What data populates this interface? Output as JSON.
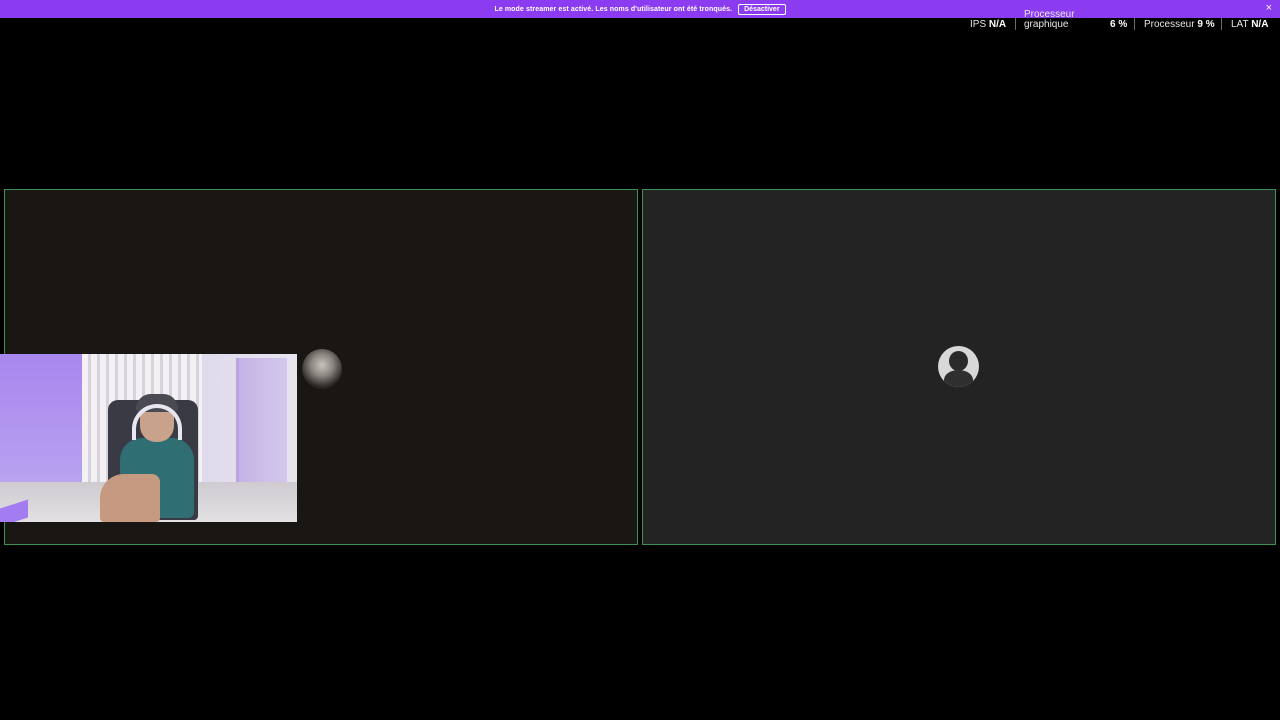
{
  "banner": {
    "message": "Le mode streamer est activé. Les noms d'utilisateur ont été tronqués.",
    "disable_label": "Désactiver",
    "close_glyph": "×",
    "background_color": "#8c3cf0"
  },
  "perf_overlay": {
    "fps_label": "IPS",
    "fps_value": "N/A",
    "gpu_label_line1": "Processeur",
    "gpu_label_line2": "graphique",
    "gpu_value": "6 %",
    "cpu_label": "Processeur",
    "cpu_value": "9 %",
    "latency_label": "LAT",
    "latency_value": "N/A"
  },
  "tiles": [
    {
      "id": "participant-1",
      "avatar_icon": "user-avatar-icon",
      "background": "#191613",
      "active_border_color": "#3f8f57"
    },
    {
      "id": "participant-2",
      "avatar_icon": "default-user-avatar-icon",
      "background": "#232323",
      "active_border_color": "#3f8f57"
    }
  ],
  "webcam_preview": {
    "icon": "camera-preview"
  }
}
